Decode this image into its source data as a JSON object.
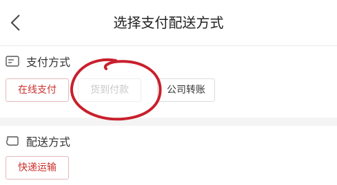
{
  "header": {
    "title": "选择支付配送方式"
  },
  "payment": {
    "section_label": "支付方式",
    "options": [
      {
        "label": "在线支付",
        "state": "selected"
      },
      {
        "label": "货到付款",
        "state": "disabled"
      },
      {
        "label": "公司转账",
        "state": "normal"
      }
    ]
  },
  "shipping": {
    "section_label": "配送方式",
    "options": [
      {
        "label": "快递运输",
        "state": "selected"
      }
    ]
  },
  "colors": {
    "accent": "#c9302c",
    "annotation": "#c8202c"
  }
}
